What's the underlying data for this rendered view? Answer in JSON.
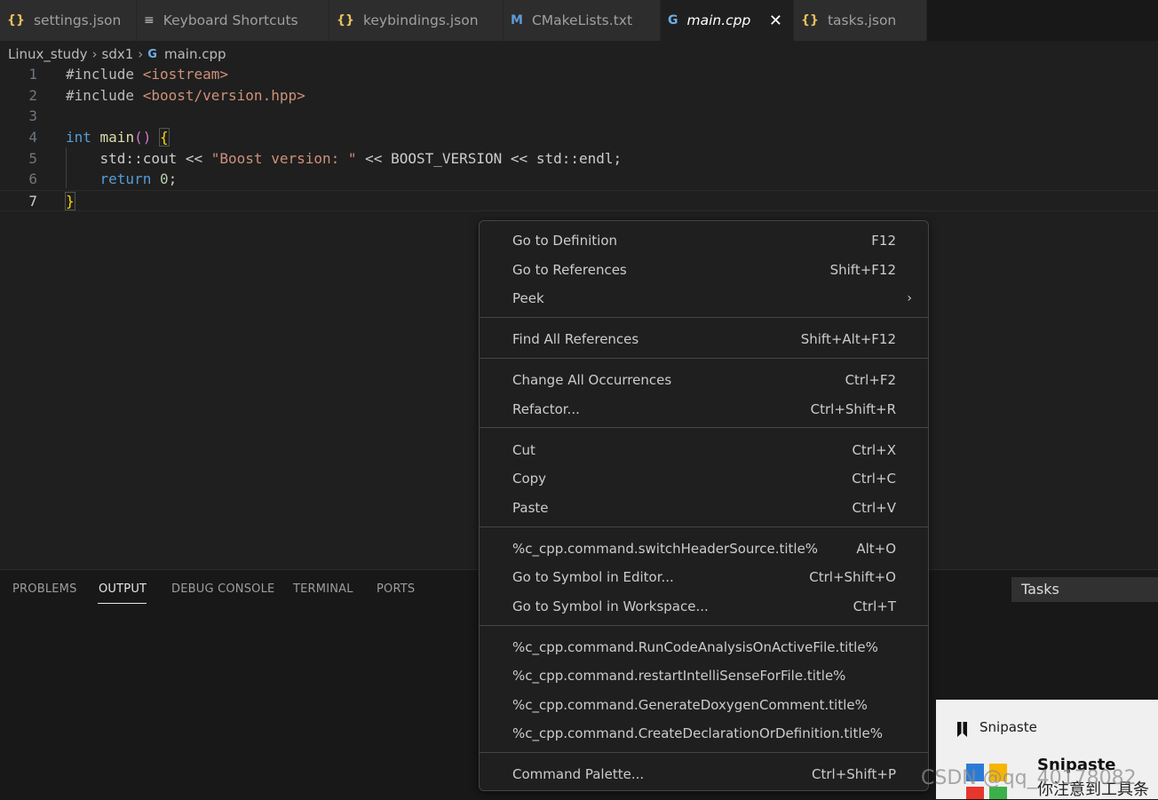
{
  "tabs": [
    {
      "label": "settings.json",
      "icon": "json-braces-icon"
    },
    {
      "label": "Keyboard Shortcuts",
      "icon": "keyboard-shortcuts-icon"
    },
    {
      "label": "keybindings.json",
      "icon": "json-braces-icon"
    },
    {
      "label": "CMakeLists.txt",
      "icon": "cmake-icon"
    },
    {
      "label": "main.cpp",
      "icon": "cpp-file-icon",
      "active": true
    },
    {
      "label": "tasks.json",
      "icon": "json-braces-icon"
    }
  ],
  "breadcrumb": {
    "parts": [
      "Linux_study",
      "sdx1",
      "main.cpp"
    ]
  },
  "editor": {
    "line_numbers": [
      "1",
      "2",
      "3",
      "4",
      "5",
      "6",
      "7"
    ],
    "lines": [
      [
        "#include ",
        "<iostream>"
      ],
      [
        "#include ",
        "<boost/version.hpp>"
      ],
      [],
      [
        "int",
        " main",
        "()",
        " ",
        "{"
      ],
      [
        "    std::cout << ",
        "\"Boost version: \"",
        " << BOOST_VERSION << std::endl;"
      ],
      [
        "    ",
        "return",
        " ",
        "0",
        ";"
      ],
      [
        "}"
      ]
    ]
  },
  "context_menu": {
    "groups": [
      [
        {
          "label": "Go to Definition",
          "key": "F12"
        },
        {
          "label": "Go to References",
          "key": "Shift+F12"
        },
        {
          "label": "Peek",
          "key": "",
          "submenu": true
        }
      ],
      [
        {
          "label": "Find All References",
          "key": "Shift+Alt+F12"
        }
      ],
      [
        {
          "label": "Change All Occurrences",
          "key": "Ctrl+F2"
        },
        {
          "label": "Refactor...",
          "key": "Ctrl+Shift+R"
        }
      ],
      [
        {
          "label": "Cut",
          "key": "Ctrl+X"
        },
        {
          "label": "Copy",
          "key": "Ctrl+C"
        },
        {
          "label": "Paste",
          "key": "Ctrl+V"
        }
      ],
      [
        {
          "label": "%c_cpp.command.switchHeaderSource.title%",
          "key": "Alt+O"
        },
        {
          "label": "Go to Symbol in Editor...",
          "key": "Ctrl+Shift+O"
        },
        {
          "label": "Go to Symbol in Workspace...",
          "key": "Ctrl+T"
        }
      ],
      [
        {
          "label": "%c_cpp.command.RunCodeAnalysisOnActiveFile.title%",
          "key": ""
        },
        {
          "label": "%c_cpp.command.restartIntelliSenseForFile.title%",
          "key": ""
        },
        {
          "label": "%c_cpp.command.GenerateDoxygenComment.title%",
          "key": ""
        },
        {
          "label": "%c_cpp.command.CreateDeclarationOrDefinition.title%",
          "key": ""
        }
      ],
      [
        {
          "label": "Command Palette...",
          "key": "Ctrl+Shift+P"
        }
      ]
    ]
  },
  "panel": {
    "tabs": [
      "PROBLEMS",
      "OUTPUT",
      "DEBUG CONSOLE",
      "TERMINAL",
      "PORTS"
    ],
    "active_tab": "OUTPUT",
    "dropdown_value": "Tasks"
  },
  "snipaste": {
    "title": "Snipaste",
    "name": "Snipaste",
    "subtitle": "你注意到工具条"
  },
  "watermark": "CSDN @qq_40178082",
  "colors": {
    "editor_bg": "#1f1f1f",
    "menu_bg": "#1f1f1f",
    "keyword": "#569cd6",
    "string": "#ce9178",
    "json_icon": "#e5c15c"
  }
}
